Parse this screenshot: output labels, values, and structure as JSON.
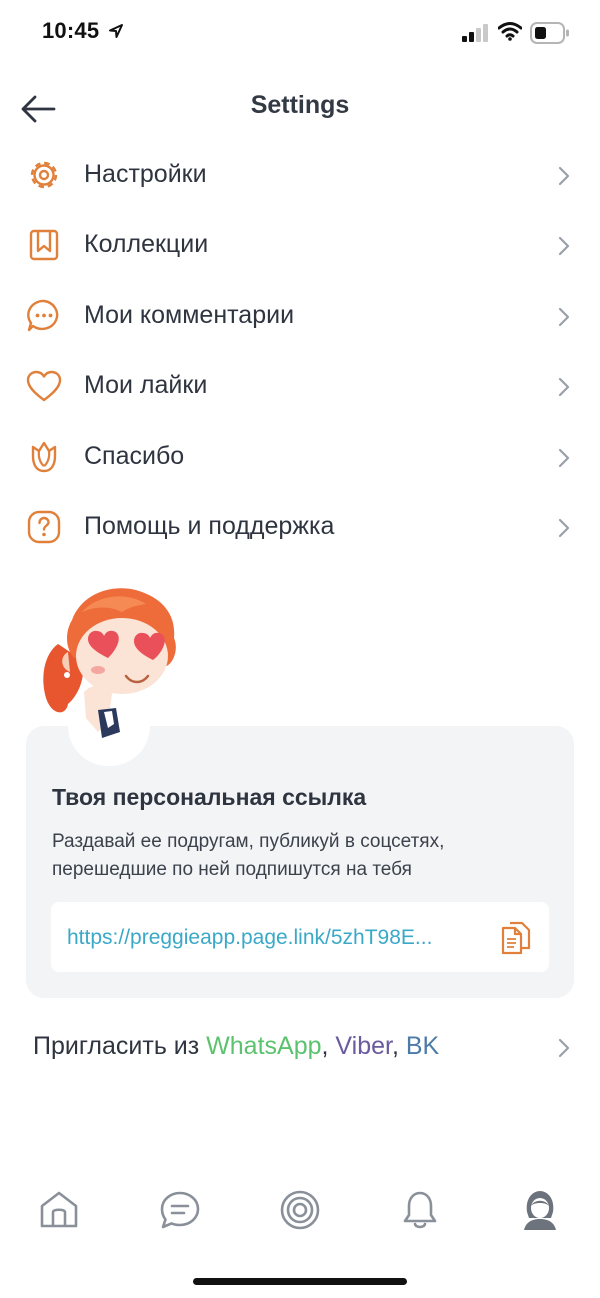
{
  "status_bar": {
    "time": "10:45"
  },
  "header": {
    "title": "Settings"
  },
  "menu": {
    "items": [
      {
        "label": "Настройки",
        "icon": "gear-icon"
      },
      {
        "label": "Коллекции",
        "icon": "bookmark-icon"
      },
      {
        "label": "Мои комментарии",
        "icon": "comment-icon"
      },
      {
        "label": "Мои лайки",
        "icon": "heart-icon"
      },
      {
        "label": "Спасибо",
        "icon": "flower-icon"
      },
      {
        "label": "Помощь и поддержка",
        "icon": "help-icon"
      }
    ]
  },
  "link_card": {
    "title": "Твоя персональная ссылка",
    "description": "Раздавай ее подругам, публикуй в соцсетях, перешедшие по ней подпишутся на тебя",
    "url": "https://preggieapp.page.link/5zhT98E..."
  },
  "invite": {
    "prefix": "Пригласить из ",
    "whatsapp": "WhatsApp",
    "sep1": ", ",
    "viber": "Viber",
    "sep2": ", ",
    "vk": "BK"
  },
  "colors": {
    "accent": "#E0803A",
    "link": "#3AA9C7",
    "whatsapp": "#5CC26E",
    "viber": "#6A5A9F",
    "vk": "#4D7BA8",
    "tab_icon": "#8A9099"
  },
  "tab_bar": {
    "tabs": [
      {
        "icon": "home-icon"
      },
      {
        "icon": "chat-icon"
      },
      {
        "icon": "target-icon"
      },
      {
        "icon": "bell-icon"
      },
      {
        "icon": "profile-icon"
      }
    ]
  }
}
